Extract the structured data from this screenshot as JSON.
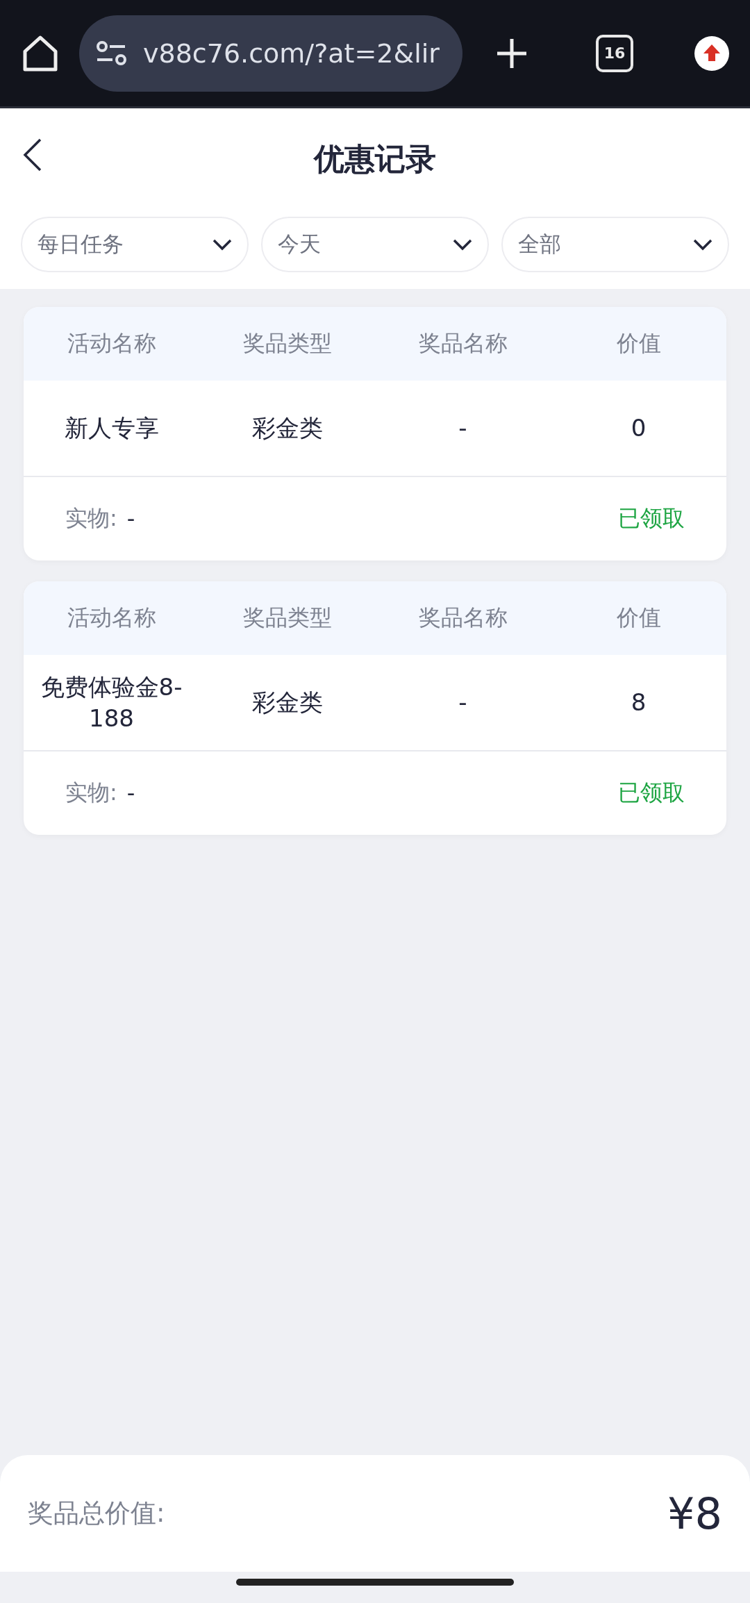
{
  "browser": {
    "url": "v88c76.com/?at=2&lir",
    "tab_count": "16"
  },
  "header": {
    "title": "优惠记录"
  },
  "filters": [
    {
      "value": "每日任务"
    },
    {
      "value": "今天"
    },
    {
      "value": "全部"
    }
  ],
  "records": [
    {
      "columns": [
        "活动名称",
        "奖品类型",
        "奖品名称",
        "价值"
      ],
      "cells": [
        "新人专享",
        "彩金类",
        "-",
        "0"
      ],
      "item_label": "实物:",
      "item_value": "-",
      "status": "已领取"
    },
    {
      "columns": [
        "活动名称",
        "奖品类型",
        "奖品名称",
        "价值"
      ],
      "cells": [
        "免费体验金8-188",
        "彩金类",
        "-",
        "8"
      ],
      "item_label": "实物:",
      "item_value": "-",
      "status": "已领取"
    }
  ],
  "summary": {
    "label": "奖品总价值:",
    "value": "¥8"
  }
}
